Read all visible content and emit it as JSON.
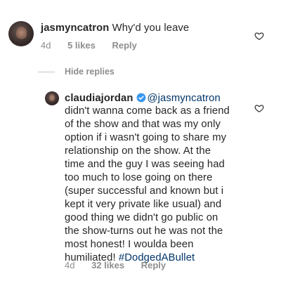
{
  "comment1": {
    "username": "jasmyncatron",
    "text": "Why'd you leave",
    "time": "4d",
    "likes": "5 likes",
    "reply": "Reply"
  },
  "hide_replies": "Hide replies",
  "comment2": {
    "username": "claudiajordan",
    "mention": "@jasmyncatron",
    "lines": [
      "didn't wanna come back as a friend",
      "of the show and that was my only",
      "option if i wasn't going to share my",
      "relationship on the show. At the",
      "time and the guy I was seeing had",
      "too much to lose going on there",
      "(super successful and known but i",
      "kept it very private like usual) and",
      "good thing we didn't go public on",
      "the show-turns out he was not the",
      "most honest! I woulda been",
      "humiliated!"
    ],
    "hashtag": "#DodgedABullet",
    "time": "4d",
    "likes": "32 likes",
    "reply": "Reply"
  },
  "icons": {
    "heart": "heart-outline-icon",
    "verified": "verified-badge-icon",
    "verified_color": "#3897f0"
  }
}
